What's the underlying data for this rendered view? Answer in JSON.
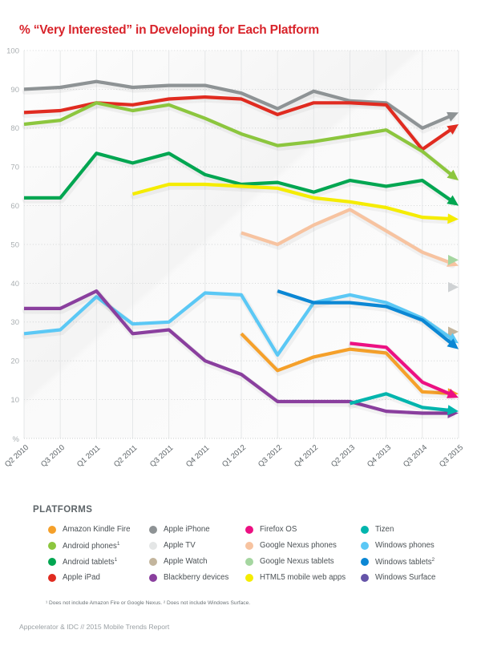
{
  "title": "% “Very Interested” in Developing for Each Platform",
  "legend": {
    "heading": "PLATFORMS",
    "items": [
      {
        "label": "Amazon Kindle Fire",
        "sup": "",
        "color": "#f5a02a",
        "col": 0,
        "row": 0
      },
      {
        "label": "Android phones",
        "sup": "1",
        "color": "#8cc63e",
        "col": 0,
        "row": 1
      },
      {
        "label": "Android tablets",
        "sup": "1",
        "color": "#00a651",
        "col": 0,
        "row": 2
      },
      {
        "label": "Apple iPad",
        "sup": "",
        "color": "#e02b20",
        "col": 0,
        "row": 3
      },
      {
        "label": "Apple iPhone",
        "sup": "",
        "color": "#8e9395",
        "col": 1,
        "row": 0
      },
      {
        "label": "Apple TV",
        "sup": "",
        "color": "#e4e6e6",
        "col": 1,
        "row": 1
      },
      {
        "label": "Apple Watch",
        "sup": "",
        "color": "#c3b59d",
        "col": 1,
        "row": 2
      },
      {
        "label": "Blackberry devices",
        "sup": "",
        "color": "#8a3f9e",
        "col": 1,
        "row": 3
      },
      {
        "label": "Firefox OS",
        "sup": "",
        "color": "#ec1082",
        "col": 2,
        "row": 0
      },
      {
        "label": "Google Nexus phones",
        "sup": "",
        "color": "#f7c3a0",
        "col": 2,
        "row": 1
      },
      {
        "label": "Google Nexus tablets",
        "sup": "",
        "color": "#a5d6a0",
        "col": 2,
        "row": 2
      },
      {
        "label": "HTML5 mobile web apps",
        "sup": "",
        "color": "#f5ec00",
        "col": 2,
        "row": 3
      },
      {
        "label": "Tizen",
        "sup": "",
        "color": "#00b5ad",
        "col": 3,
        "row": 0
      },
      {
        "label": "Windows phones",
        "sup": "",
        "color": "#5bc8f5",
        "col": 3,
        "row": 1
      },
      {
        "label": "Windows tablets",
        "sup": "2",
        "color": "#0b87d4",
        "col": 3,
        "row": 2
      },
      {
        "label": "Windows Surface",
        "sup": "",
        "color": "#6554a8",
        "col": 3,
        "row": 3
      }
    ]
  },
  "footnote": "¹ Does not include Amazon Fire or Google Nexus. ² Does not include Windows Surface.",
  "source": "Appcelerator & IDC // 2015 Mobile Trends Report",
  "axis": {
    "y_unit": "%",
    "y_ticks": [
      "100",
      "90",
      "80",
      "70",
      "60",
      "50",
      "40",
      "30",
      "20",
      "10"
    ]
  },
  "chart_data": {
    "type": "line",
    "title": "% “Very Interested” in Developing for Each Platform",
    "xlabel": "",
    "ylabel": "%",
    "ylim": [
      0,
      100
    ],
    "grid": true,
    "legend_position": "bottom",
    "categories": [
      "Q2 2010",
      "Q3 2010",
      "Q1 2011",
      "Q2 2011",
      "Q3 2011",
      "Q4 2011",
      "Q1 2012",
      "Q3 2012",
      "Q4 2012",
      "Q2 2013",
      "Q4 2013",
      "Q3 2014",
      "Q3 2015"
    ],
    "series": [
      {
        "name": "Apple iPhone",
        "color": "#8e9395",
        "values": [
          90,
          90.5,
          92,
          90.5,
          91,
          91,
          89,
          85,
          89.5,
          87,
          86.5,
          80,
          84
        ]
      },
      {
        "name": "Apple iPad",
        "color": "#e02b20",
        "values": [
          84,
          84.5,
          86.5,
          86,
          87.5,
          88,
          87.5,
          83.5,
          86.5,
          86.5,
          86,
          74.5,
          81
        ]
      },
      {
        "name": "Android phones",
        "color": "#8cc63e",
        "values": [
          81,
          82,
          86.5,
          84.5,
          86,
          82.5,
          78.5,
          75.5,
          76.5,
          78,
          79.5,
          74,
          66.5
        ]
      },
      {
        "name": "Android tablets",
        "color": "#00a651",
        "values": [
          62,
          62,
          73.5,
          71,
          73.5,
          68,
          65.5,
          66,
          63.5,
          66.5,
          65,
          66.5,
          60
        ]
      },
      {
        "name": "HTML5 mobile web apps",
        "color": "#f5ec00",
        "values": [
          null,
          null,
          null,
          63,
          65.5,
          65.5,
          65,
          64.5,
          62,
          61,
          59.5,
          57,
          56.5
        ]
      },
      {
        "name": "Google Nexus phones",
        "color": "#f7c3a0",
        "values": [
          null,
          null,
          null,
          null,
          null,
          null,
          53,
          50,
          55,
          59,
          53.5,
          48,
          44.5
        ]
      },
      {
        "name": "Google Nexus tablets",
        "color": "#a5d6a0",
        "values": [
          null,
          null,
          null,
          null,
          null,
          null,
          null,
          null,
          null,
          null,
          null,
          null,
          46
        ]
      },
      {
        "name": "Apple TV",
        "color": "#cfd2d4",
        "values": [
          null,
          null,
          null,
          null,
          null,
          null,
          null,
          null,
          null,
          null,
          null,
          null,
          39
        ]
      },
      {
        "name": "Apple Watch",
        "color": "#c3b59d",
        "values": [
          null,
          null,
          null,
          null,
          null,
          null,
          null,
          null,
          null,
          null,
          null,
          null,
          27.5
        ]
      },
      {
        "name": "Windows phones",
        "color": "#5bc8f5",
        "values": [
          27,
          28,
          36.5,
          29.5,
          30,
          37.5,
          37,
          21.5,
          35,
          37,
          35,
          31,
          24.5
        ]
      },
      {
        "name": "Windows tablets",
        "color": "#0b87d4",
        "values": [
          null,
          null,
          null,
          null,
          null,
          null,
          null,
          38,
          35,
          35,
          34,
          30.5,
          23
        ]
      },
      {
        "name": "Blackberry devices",
        "color": "#8a3f9e",
        "values": [
          33.5,
          33.5,
          38,
          27,
          28,
          20,
          16.5,
          9.5,
          9.5,
          9.5,
          7,
          6.5,
          6.5
        ]
      },
      {
        "name": "Amazon Kindle Fire",
        "color": "#f5a02a",
        "values": [
          null,
          null,
          null,
          null,
          null,
          null,
          27,
          17.5,
          21,
          23,
          22,
          12,
          11.5
        ]
      },
      {
        "name": "Firefox OS",
        "color": "#ec1082",
        "values": [
          null,
          null,
          null,
          null,
          null,
          null,
          null,
          null,
          null,
          24.5,
          23.5,
          14.5,
          10.5
        ]
      },
      {
        "name": "Tizen",
        "color": "#00b5ad",
        "values": [
          null,
          null,
          null,
          null,
          null,
          null,
          null,
          null,
          null,
          9,
          11.5,
          8,
          7
        ]
      }
    ]
  }
}
